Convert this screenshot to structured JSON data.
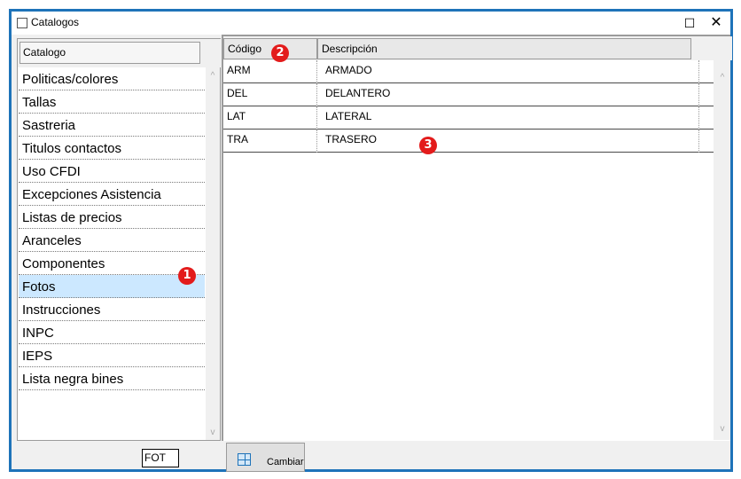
{
  "window": {
    "title": "Catalogos",
    "maximize_glyph": "☐",
    "close_glyph": "✕"
  },
  "left_panel": {
    "header": "Catalogo",
    "items": [
      {
        "label": "Politicas/colores"
      },
      {
        "label": "Tallas"
      },
      {
        "label": "Sastreria"
      },
      {
        "label": "Titulos contactos"
      },
      {
        "label": "Uso CFDI"
      },
      {
        "label": "Excepciones Asistencia"
      },
      {
        "label": "Listas de precios"
      },
      {
        "label": "Aranceles"
      },
      {
        "label": "Componentes"
      },
      {
        "label": "Fotos"
      },
      {
        "label": "Instrucciones"
      },
      {
        "label": "INPC"
      },
      {
        "label": "IEPS"
      },
      {
        "label": "Lista negra bines"
      }
    ],
    "selected_index": 9,
    "scroll_up_glyph": "^",
    "scroll_down_glyph": "v"
  },
  "grid": {
    "columns": [
      "Código",
      "Descripción"
    ],
    "rows": [
      {
        "code": "ARM",
        "description": "ARMADO"
      },
      {
        "code": "DEL",
        "description": "DELANTERO"
      },
      {
        "code": "LAT",
        "description": "LATERAL"
      },
      {
        "code": "TRA",
        "description": "TRASERO"
      }
    ],
    "scroll_up_glyph": "^",
    "scroll_down_glyph": "v"
  },
  "bottom": {
    "field_value": "FOT",
    "change_button_label": "Cambiar"
  },
  "annotations": [
    "1",
    "2",
    "3"
  ],
  "colors": {
    "window_border": "#1e73b9",
    "selected_row": "#cce8ff",
    "badge": "#e31b1b"
  }
}
